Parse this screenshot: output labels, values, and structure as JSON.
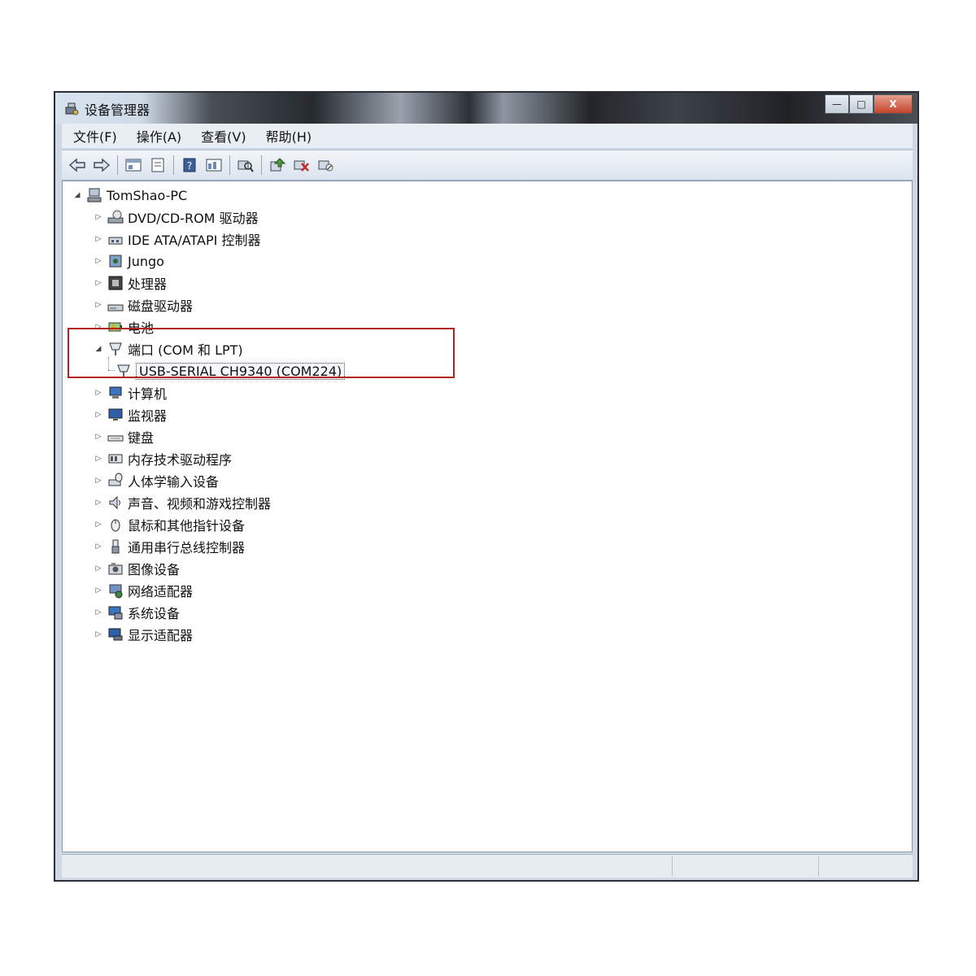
{
  "window": {
    "title": "设备管理器",
    "buttons": {
      "minimize": "—",
      "maximize": "□",
      "close": "X"
    }
  },
  "menu": [
    {
      "label": "文件(F)"
    },
    {
      "label": "操作(A)"
    },
    {
      "label": "查看(V)"
    },
    {
      "label": "帮助(H)"
    }
  ],
  "toolbar": [
    "back-arrow-icon",
    "forward-arrow-icon",
    "properties-icon",
    "sheet-icon",
    "help-icon",
    "view-icon",
    "scan-hardware-icon",
    "update-driver-icon",
    "uninstall-icon",
    "disable-icon"
  ],
  "tree": {
    "root": "TomShao-PC",
    "items": [
      {
        "label": "DVD/CD-ROM 驱动器",
        "icon": "dvd-drive-icon"
      },
      {
        "label": "IDE ATA/ATAPI 控制器",
        "icon": "ide-controller-icon"
      },
      {
        "label": "Jungo",
        "icon": "jungo-device-icon"
      },
      {
        "label": "处理器",
        "icon": "processor-icon"
      },
      {
        "label": "磁盘驱动器",
        "icon": "disk-drive-icon"
      },
      {
        "label": "电池",
        "icon": "battery-icon"
      },
      {
        "label": "端口 (COM 和 LPT)",
        "icon": "port-icon",
        "expanded": true,
        "children": [
          {
            "label": "USB-SERIAL CH9340 (COM224)",
            "icon": "serial-port-icon"
          }
        ]
      },
      {
        "label": "计算机",
        "icon": "computer-icon"
      },
      {
        "label": "监视器",
        "icon": "monitor-icon"
      },
      {
        "label": "键盘",
        "icon": "keyboard-icon"
      },
      {
        "label": "内存技术驱动程序",
        "icon": "memory-tech-icon"
      },
      {
        "label": "人体学输入设备",
        "icon": "hid-icon"
      },
      {
        "label": "声音、视频和游戏控制器",
        "icon": "sound-icon"
      },
      {
        "label": "鼠标和其他指针设备",
        "icon": "mouse-icon"
      },
      {
        "label": "通用串行总线控制器",
        "icon": "usb-icon"
      },
      {
        "label": "图像设备",
        "icon": "imaging-icon"
      },
      {
        "label": "网络适配器",
        "icon": "network-icon"
      },
      {
        "label": "系统设备",
        "icon": "system-device-icon"
      },
      {
        "label": "显示适配器",
        "icon": "display-adapter-icon"
      }
    ]
  },
  "colors": {
    "highlight": "#b52020",
    "window_frame": "#cfd9e6"
  }
}
